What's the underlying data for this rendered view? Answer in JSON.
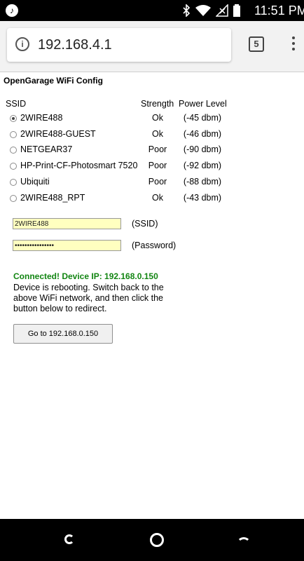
{
  "status_bar": {
    "time": "11:51 PM"
  },
  "browser": {
    "url": "192.168.4.1",
    "tab_count": "5"
  },
  "page": {
    "title": "OpenGarage WiFi Config",
    "headers": {
      "ssid": "SSID",
      "strength": "Strength",
      "power": "Power Level"
    },
    "networks": [
      {
        "ssid": "2WIRE488",
        "strength": "Ok",
        "power": "(-45 dbm)",
        "selected": true
      },
      {
        "ssid": "2WIRE488-GUEST",
        "strength": "Ok",
        "power": "(-46 dbm)",
        "selected": false
      },
      {
        "ssid": "NETGEAR37",
        "strength": "Poor",
        "power": "(-90 dbm)",
        "selected": false
      },
      {
        "ssid": "HP-Print-CF-Photosmart 7520",
        "strength": "Poor",
        "power": "(-92 dbm)",
        "selected": false
      },
      {
        "ssid": "Ubiquiti",
        "strength": "Poor",
        "power": "(-88 dbm)",
        "selected": false
      },
      {
        "ssid": "2WIRE488_RPT",
        "strength": "Ok",
        "power": "(-43 dbm)",
        "selected": false
      }
    ],
    "ssid_field": {
      "value": "2WIRE488",
      "label": "(SSID)"
    },
    "password_field": {
      "value": "••••••••••••••••",
      "label": "(Password)"
    },
    "connected_text": "Connected! Device IP: 192.168.0.150",
    "message_text": "Device is rebooting. Switch back to the above WiFi network, and then click the button below to redirect.",
    "redirect_button": "Go to 192.168.0.150"
  },
  "colors": {
    "connected": "#128512",
    "field_bg": "#ffffc0"
  }
}
